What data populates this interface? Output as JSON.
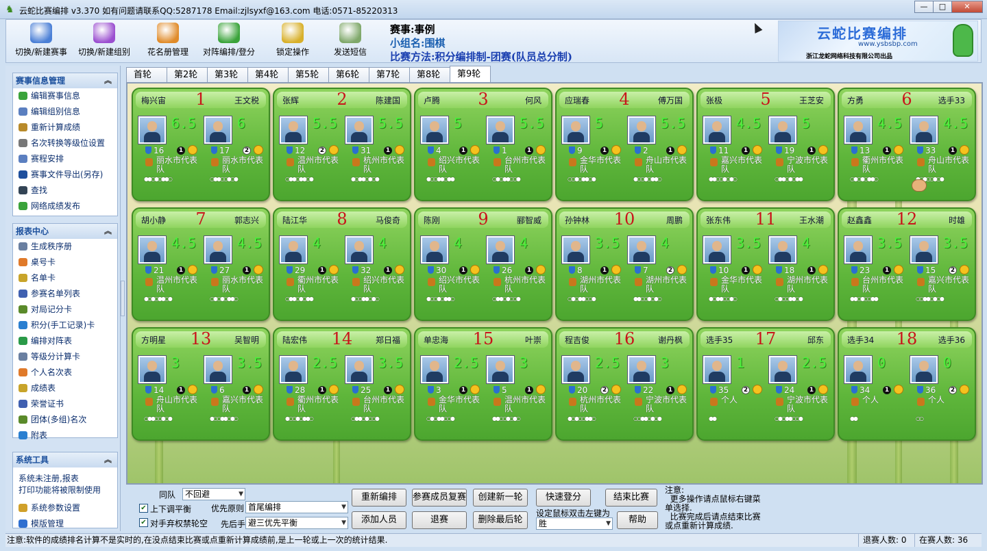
{
  "window": {
    "title": "云蛇比赛编排 v3.370   如有问题请联系QQ:5287178 Email:zjlsyxf@163.com 电话:0571-85220313",
    "min": "—",
    "max": "□",
    "close": "✕"
  },
  "toolbar": {
    "items": [
      {
        "label": "切换/新建赛事",
        "icon": "calendar-icon",
        "color": "#4a7fd6"
      },
      {
        "label": "切换/新建组别",
        "icon": "group-icon",
        "color": "#9b4fd0"
      },
      {
        "label": "花名册管理",
        "icon": "roster-icon",
        "color": "#e08b2a"
      },
      {
        "label": "对阵编排/登分",
        "icon": "vs-shield-icon",
        "color": "#3aa33a"
      },
      {
        "label": "锁定操作",
        "icon": "lock-key-icon",
        "color": "#d8b02a"
      },
      {
        "label": "发送短信",
        "icon": "envelope-icon",
        "color": "#7fa86a"
      }
    ],
    "event_line": "赛事:事例",
    "group_line": "小组名:围棋",
    "method_line": "比赛方法:积分编排制-团赛(队员总分制)",
    "logo_title": "云蛇比赛编排",
    "logo_url": "www.ysbsbp.com",
    "logo_company": "浙江龙蛇网络科技有限公司出品"
  },
  "sidebar": {
    "info_title": "赛事信息管理",
    "info_items": [
      "编辑赛事信息",
      "编辑组别信息",
      "重新计算成绩",
      "名次转换等级位设置",
      "赛程安排",
      "赛事文件导出(另存)",
      "查找",
      "网络成绩发布"
    ],
    "report_title": "报表中心",
    "report_items": [
      "生成秩序册",
      "桌号卡",
      "名单卡",
      "参赛名单列表",
      "对局记分卡",
      "积分(手工记录)卡",
      "编排对阵表",
      "等级分计算卡",
      "个人名次表",
      "成绩表",
      "荣誉证书",
      "团体(多组)名次",
      "附表"
    ],
    "tools_title": "系统工具",
    "tools_text1": "系统未注册,报表",
    "tools_text2": "打印功能将被限制使用",
    "tools_items": [
      "系统参数设置",
      "模版管理"
    ],
    "collapse": "︽"
  },
  "tabs": [
    "首轮",
    "第2轮",
    "第3轮",
    "第4轮",
    "第5轮",
    "第6轮",
    "第7轮",
    "第8轮",
    "第9轮"
  ],
  "active_tab": 8,
  "tables": [
    {
      "no": "1",
      "lname": "梅兴宙",
      "rname": "王文税",
      "ls": "6.5",
      "rs": "6",
      "lseed": "16",
      "rseed": "17",
      "lord": "1",
      "rord": "2",
      "lteam": "丽水市代表队",
      "rteam": "丽水市代表队",
      "ldots": "●●○●○●●○",
      "rdots": "○●●○○●○●"
    },
    {
      "no": "2",
      "lname": "张辉",
      "rname": "陈建国",
      "ls": "5.5",
      "rs": "5.5",
      "lseed": "12",
      "rseed": "31",
      "lord": "2",
      "rord": "1",
      "lteam": "温州市代表队",
      "rteam": "杭州市代表队",
      "ldots": "○●●○●●○●",
      "rdots": "●○●●○●○●"
    },
    {
      "no": "3",
      "lname": "卢腾",
      "rname": "何风",
      "ls": "5",
      "rs": "5.5",
      "lseed": "4",
      "rseed": "1",
      "lord": "1",
      "rord": "1",
      "lteam": "绍兴市代表队",
      "rteam": "台州市代表队",
      "ldots": "●○○●●○●●",
      "rdots": "○●○●●○○●"
    },
    {
      "no": "4",
      "lname": "应瑞春",
      "rname": "傅万国",
      "ls": "5",
      "rs": "5.5",
      "lseed": "9",
      "rseed": "2",
      "lord": "1",
      "rord": "1",
      "lteam": "金华市代表队",
      "rteam": "舟山市代表队",
      "ldots": "○○●○●●○●",
      "rdots": "●○○●○●●○"
    },
    {
      "no": "5",
      "lname": "张极",
      "rname": "王芝安",
      "ls": "4.5",
      "rs": "5",
      "lseed": "11",
      "rseed": "19",
      "lord": "1",
      "rord": "1",
      "lteam": "嘉兴市代表队",
      "rteam": "宁波市代表队",
      "ldots": "●●○○●○●○",
      "rdots": "○●●○●○●●"
    },
    {
      "no": "6",
      "lname": "方勇",
      "rname": "选手33",
      "ls": "4.5",
      "rs": "4.5",
      "lseed": "13",
      "rseed": "33",
      "lord": "1",
      "rord": "1",
      "lteam": "衢州市代表队",
      "rteam": "舟山市代表队",
      "ldots": "○●○●○●●○",
      "rdots": "●○●○○●○●"
    },
    {
      "no": "7",
      "lname": "胡小静",
      "rname": "郭志兴",
      "ls": "4.5",
      "rs": "4.5",
      "lseed": "21",
      "rseed": "27",
      "lord": "1",
      "rord": "1",
      "lteam": "温州市代表队",
      "rteam": "丽水市代表队",
      "ldots": "●○●○●●○●",
      "rdots": "○●○●○●●○"
    },
    {
      "no": "8",
      "lname": "陆江华",
      "rname": "马俊奇",
      "ls": "4",
      "rs": "4",
      "lseed": "29",
      "rseed": "32",
      "lord": "1",
      "rord": "1",
      "lteam": "衢州市代表队",
      "rteam": "绍兴市代表队",
      "ldots": "○●●○●○●●",
      "rdots": "●○○●●○●○"
    },
    {
      "no": "9",
      "lname": "陈刚",
      "rname": "郦智威",
      "ls": "4",
      "rs": "4",
      "lseed": "30",
      "rseed": "26",
      "lord": "1",
      "rord": "1",
      "lteam": "绍兴市代表队",
      "rteam": "杭州市代表队",
      "ldots": "●○○●○●●○",
      "rdots": "○●●○●○○●"
    },
    {
      "no": "10",
      "lname": "孙钟林",
      "rname": "周鹏",
      "ls": "3.5",
      "rs": "4",
      "lseed": "8",
      "rseed": "7",
      "lord": "1",
      "rord": "2",
      "lteam": "湖州市代表队",
      "rteam": "湖州市代表队",
      "ldots": "○●○●●○○●",
      "rdots": "●●○○●○●○"
    },
    {
      "no": "11",
      "lname": "张东伟",
      "rname": "王水潮",
      "ls": "3.5",
      "rs": "4",
      "lseed": "10",
      "rseed": "18",
      "lord": "1",
      "rord": "1",
      "lteam": "金华市代表队",
      "rteam": "湖州市代表队",
      "ldots": "●○●●○○●○",
      "rdots": "○●○○●●○●"
    },
    {
      "no": "12",
      "lname": "赵鑫鑫",
      "rname": "时雄",
      "ls": "3.5",
      "rs": "3.5",
      "lseed": "23",
      "rseed": "15",
      "lord": "1",
      "rord": "2",
      "lteam": "台州市代表队",
      "rteam": "嘉兴市代表队",
      "ldots": "●●○●○○●●",
      "rdots": "○○●●○●○●"
    },
    {
      "no": "13",
      "lname": "方明星",
      "rname": "吴智明",
      "ls": "3",
      "rs": "3.5",
      "lseed": "14",
      "rseed": "6",
      "lord": "1",
      "rord": "1",
      "lteam": "舟山市代表队",
      "rteam": "嘉兴市代表队",
      "ldots": "○●●○○●○●",
      "rdots": "●○○●●○●○"
    },
    {
      "no": "14",
      "lname": "陆宏伟",
      "rname": "郑日福",
      "ls": "2.5",
      "rs": "3.5",
      "lseed": "28",
      "rseed": "25",
      "lord": "1",
      "rord": "1",
      "lteam": "衢州市代表队",
      "rteam": "台州市代表队",
      "ldots": "●○○●○●●○",
      "rdots": "○●●○●○○●"
    },
    {
      "no": "15",
      "lname": "单忠海",
      "rname": "叶崇",
      "ls": "2.5",
      "rs": "3",
      "lseed": "3",
      "rseed": "5",
      "lord": "1",
      "rord": "1",
      "lteam": "金华市代表队",
      "rteam": "温州市代表队",
      "ldots": "○●○●●○○●",
      "rdots": "●●○○●○●○"
    },
    {
      "no": "16",
      "lname": "程吉俊",
      "rname": "谢丹枫",
      "ls": "2.5",
      "rs": "3",
      "lseed": "20",
      "rseed": "22",
      "lord": "2",
      "rord": "1",
      "lteam": "杭州市代表队",
      "rteam": "宁波市代表队",
      "ldots": "●○●○○●●○",
      "rdots": "○○●●○●○●"
    },
    {
      "no": "17",
      "lname": "选手35",
      "rname": "邱东",
      "ls": "1",
      "rs": "2.5",
      "lseed": "35",
      "rseed": "24",
      "lord": "2",
      "rord": "1",
      "lteam": "个人",
      "rteam": "宁波市代表队",
      "ldots": "●●",
      "rdots": "○●○●●○○●"
    },
    {
      "no": "18",
      "lname": "选手34",
      "rname": "选手36",
      "ls": "0",
      "rs": "0",
      "lseed": "34",
      "rseed": "36",
      "lord": "1",
      "rord": "2",
      "lteam": "个人",
      "rteam": "个人",
      "ldots": "●●",
      "rdots": "○○"
    }
  ],
  "bottom": {
    "same_team_label": "同队",
    "same_team_value": "不回避",
    "updown_label": "上下调平衡",
    "priority_label": "优先原则",
    "priority_value": "首尾编排",
    "forfeit_label": "对手弃权禁轮空",
    "first_move_label": "先后手",
    "first_move_value": "避三优先平衡",
    "buttons": [
      "重新编排",
      "参赛成员复赛",
      "创建新一轮",
      "快速登分",
      "结束比赛",
      "添加人员",
      "退赛",
      "删除最后轮",
      "帮助"
    ],
    "dblclick_label": "设定鼠标双击左键为",
    "dblclick_value": "胜",
    "note": "注意:\n  更多操作请点鼠标右键菜单选择.\n  比赛完成后请点结束比赛或点重新计算成绩."
  },
  "status": {
    "message": "注意:软件的成绩排名计算不是实时的,在没点结束比赛或点重新计算成绩前,是上一轮或上一次的统计结果.",
    "withdrawn": "退赛人数: 0",
    "active": "在赛人数: 36"
  }
}
